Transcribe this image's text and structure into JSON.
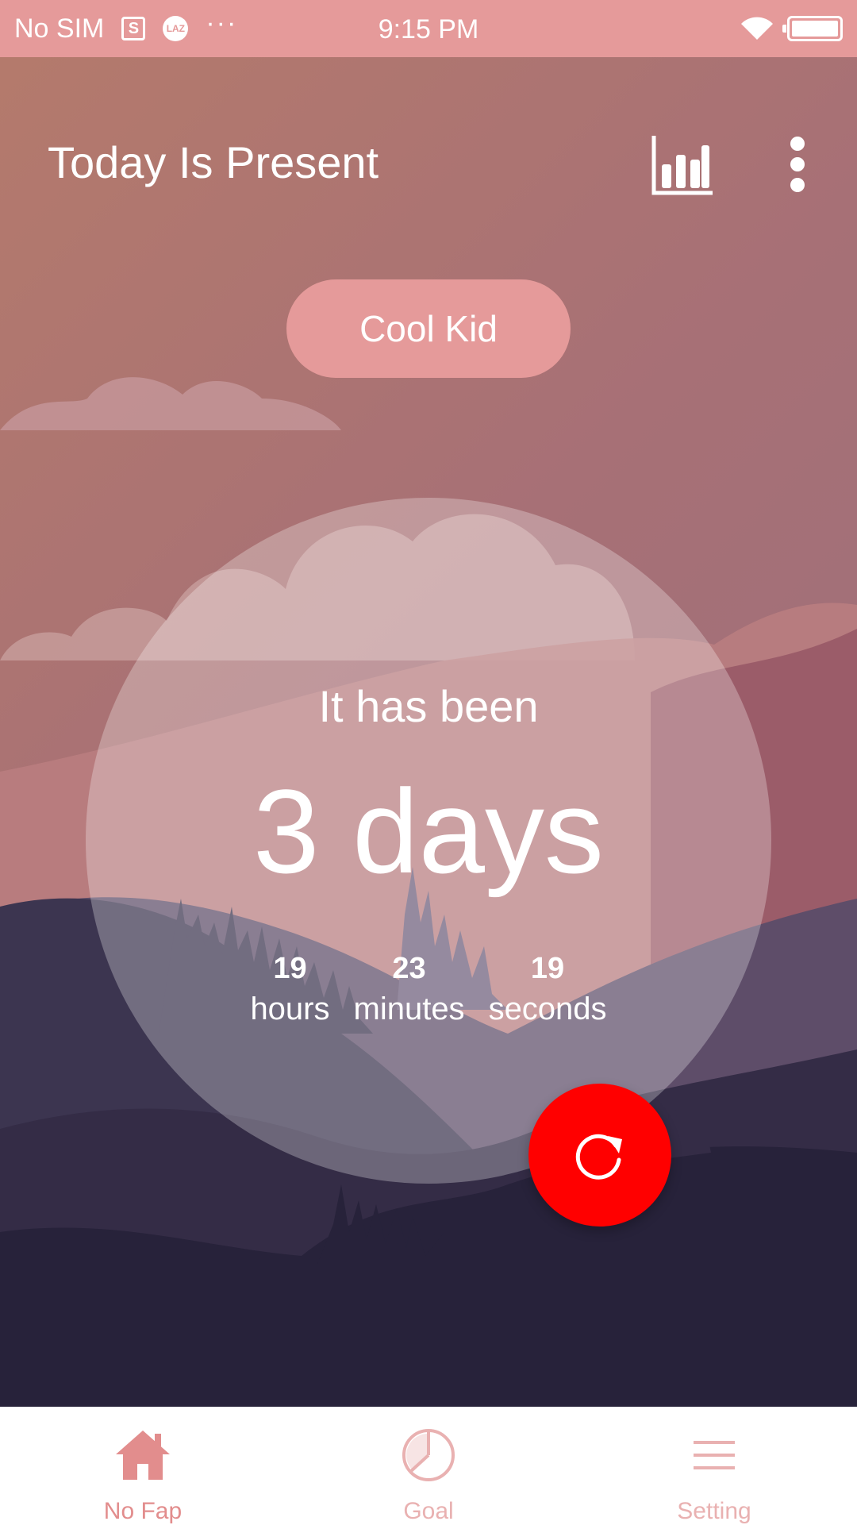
{
  "status_bar": {
    "carrier": "No SIM",
    "sim_icon_text": "S",
    "laz_icon_text": "LAZ",
    "overflow": "···",
    "time": "9:15 PM"
  },
  "header": {
    "title": "Today Is Present"
  },
  "rank": {
    "label": "Cool Kid"
  },
  "timer": {
    "intro": "It has been",
    "days_text": "3 days",
    "units": [
      {
        "value": "19",
        "label": "hours"
      },
      {
        "value": "23",
        "label": "minutes"
      },
      {
        "value": "19",
        "label": "seconds"
      }
    ]
  },
  "bottom_nav": {
    "items": [
      {
        "label": "No Fap",
        "icon": "home-icon",
        "active": true
      },
      {
        "label": "Goal",
        "icon": "pie-chart-icon",
        "active": false
      },
      {
        "label": "Setting",
        "icon": "menu-lines-icon",
        "active": false
      }
    ]
  },
  "colors": {
    "accent_pink": "#e59a9a",
    "reset_red": "#ff0000",
    "nav_active": "#e28d8d",
    "nav_inactive": "#e9b1b1"
  }
}
